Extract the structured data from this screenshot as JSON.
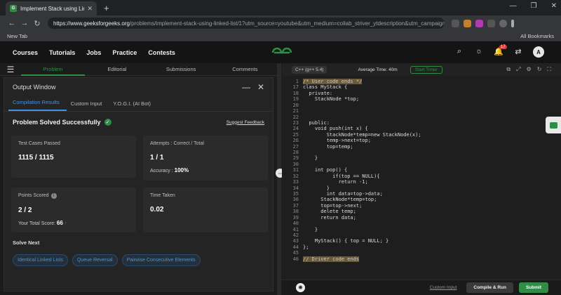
{
  "browser": {
    "tab_title": "Implement Stack using Linked L",
    "new_tab": "+",
    "window_controls": [
      "—",
      "❐",
      "✕"
    ],
    "url_domain": "https://www.geeksforgeeks.org",
    "url_rest": "/problems/implement-stack-using-linked-list/1?utm_source=youtube&utm_medium=collab_striver_ytdescription&utm_campaign=imple...",
    "bookmark_new_tab": "New Tab",
    "all_bookmarks": "All Bookmarks"
  },
  "gfg_nav": {
    "items": [
      "Courses",
      "Tutorials",
      "Jobs",
      "Practice",
      "Contests"
    ],
    "notification_count": "17",
    "avatar_letter": "A"
  },
  "problem_tabs": [
    "Problem",
    "Editorial",
    "Submissions",
    "Comments"
  ],
  "output_window": {
    "title": "Output Window",
    "tabs": [
      "Compilation Results",
      "Custom Input",
      "Y.O.G.I. (AI Bot)"
    ],
    "status": "Problem Solved Successfully",
    "feedback_link": "Suggest Feedback",
    "cards": {
      "test_cases_label": "Test Cases Passed",
      "test_cases_value": "1115 / 1115",
      "attempts_label": "Attempts : Correct / Total",
      "attempts_value": "1 / 1",
      "accuracy_label": "Accuracy :",
      "accuracy_value": "100%",
      "points_label": "Points Scored",
      "points_value": "2 / 2",
      "total_score_label": "Your Total Score:",
      "total_score_value": "66",
      "time_label": "Time Taken",
      "time_value": "0.02"
    },
    "solve_next_title": "Solve Next",
    "solve_next": [
      "Identical Linked Lists",
      "Queue Reversal",
      "Pairwise Consecutive Elements"
    ]
  },
  "editor": {
    "language": "C++ (g++ 5.4)",
    "avg_time": "Average Time: 40m",
    "start_timer": "Start Timer",
    "custom_input": "Custom Input",
    "compile_run": "Compile & Run",
    "submit": "Submit",
    "lines": [
      {
        "n": "1",
        "t": "/* User code ends */"
      },
      {
        "n": "17",
        "t": "class MyStack {"
      },
      {
        "n": "18",
        "t": "  private:"
      },
      {
        "n": "19",
        "t": "    StackNode *top;"
      },
      {
        "n": "20",
        "t": ""
      },
      {
        "n": "21",
        "t": ""
      },
      {
        "n": "22",
        "t": ""
      },
      {
        "n": "23",
        "t": "  public:"
      },
      {
        "n": "24",
        "t": "    void push(int x) {"
      },
      {
        "n": "25",
        "t": "        StackNode*temp=new StackNode(x);"
      },
      {
        "n": "26",
        "t": "        temp->next=top;"
      },
      {
        "n": "27",
        "t": "        top=temp;"
      },
      {
        "n": "28",
        "t": ""
      },
      {
        "n": "29",
        "t": "    }"
      },
      {
        "n": "30",
        "t": ""
      },
      {
        "n": "31",
        "t": "    int pop() {"
      },
      {
        "n": "32",
        "t": "          if(top == NULL){"
      },
      {
        "n": "33",
        "t": "            return -1;"
      },
      {
        "n": "34",
        "t": "        }"
      },
      {
        "n": "35",
        "t": "        int data=top->data;"
      },
      {
        "n": "36",
        "t": "      StackNode*temp=top;"
      },
      {
        "n": "37",
        "t": "      top=top->next;"
      },
      {
        "n": "38",
        "t": "      delete temp;"
      },
      {
        "n": "39",
        "t": "      return data;"
      },
      {
        "n": "40",
        "t": ""
      },
      {
        "n": "41",
        "t": "    }"
      },
      {
        "n": "42",
        "t": ""
      },
      {
        "n": "43",
        "t": "    MyStack() { top = NULL; }"
      },
      {
        "n": "44",
        "t": "};"
      },
      {
        "n": "45",
        "t": ""
      },
      {
        "n": "46",
        "t": "// Driver code ends"
      }
    ]
  },
  "colors": {
    "gfg_green": "#2f8d46",
    "link_blue": "#4a90e2",
    "keyword_yellow": "#f2c94c"
  }
}
